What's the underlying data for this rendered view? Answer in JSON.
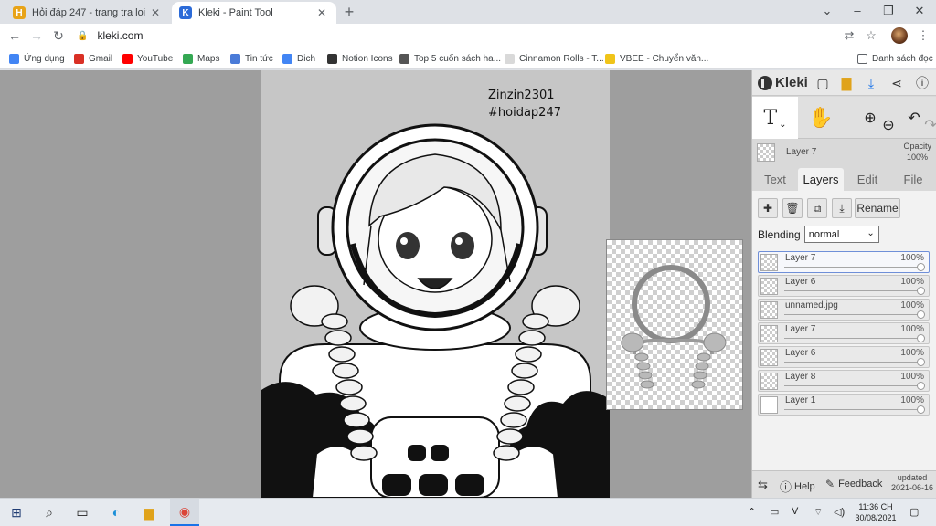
{
  "browser": {
    "tabs": [
      {
        "title": "Hỏi đáp 247 - trang tra loi",
        "active": false,
        "favicon_color": "#e8a317"
      },
      {
        "title": "Kleki - Paint Tool",
        "active": true,
        "favicon_color": "#2c6bd8"
      }
    ],
    "url": "kleki.com",
    "bookmarks": [
      {
        "label": "Ứng dụng",
        "color": "#4285f4"
      },
      {
        "label": "Gmail",
        "color": "#d93025"
      },
      {
        "label": "YouTube",
        "color": "#ff0000"
      },
      {
        "label": "Maps",
        "color": "#34a853"
      },
      {
        "label": "Tin tức",
        "color": "#4a7bd8"
      },
      {
        "label": "Dich",
        "color": "#4285f4"
      },
      {
        "label": "Notion Icons",
        "color": "#333333"
      },
      {
        "label": "Top 5 cuốn sách ha...",
        "color": "#555555"
      },
      {
        "label": "Cinnamon Rolls - T...",
        "color": "#d9d9d9"
      },
      {
        "label": "VBEE - Chuyển văn...",
        "color": "#f0c419"
      }
    ],
    "reading_list": "Danh sách đọc"
  },
  "canvas": {
    "signature_line1": "Zinzin2301",
    "signature_line2": "#hoidap247"
  },
  "kleki": {
    "brand": "Kleki",
    "current_layer": "Layer 7",
    "opacity_label": "Opacity",
    "opacity_value": "100%",
    "tabs": [
      "Text",
      "Layers",
      "Edit",
      "File"
    ],
    "active_tab": "Layers",
    "rename_label": "Rename",
    "blending_label": "Blending",
    "blending_value": "normal",
    "layers": [
      {
        "name": "Layer 7",
        "opacity": "100%",
        "selected": true
      },
      {
        "name": "Layer 6",
        "opacity": "100%",
        "selected": false
      },
      {
        "name": "unnamed.jpg",
        "opacity": "100%",
        "selected": false
      },
      {
        "name": "Layer 7",
        "opacity": "100%",
        "selected": false
      },
      {
        "name": "Layer 6",
        "opacity": "100%",
        "selected": false
      },
      {
        "name": "Layer 8",
        "opacity": "100%",
        "selected": false
      },
      {
        "name": "Layer 1",
        "opacity": "100%",
        "selected": false
      }
    ],
    "help": "Help",
    "feedback": "Feedback",
    "updated_label": "updated",
    "updated_date": "2021-06-16"
  },
  "taskbar": {
    "time": "11:36 CH",
    "date": "30/08/2021"
  }
}
